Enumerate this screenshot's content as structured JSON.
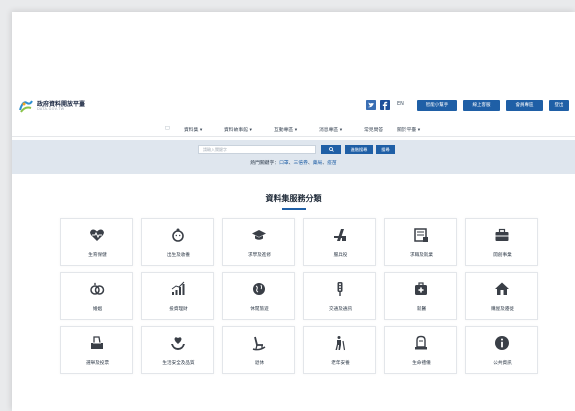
{
  "header": {
    "site_title": "政府資料開放平臺",
    "site_subtitle": "DATA.GOV.TW",
    "social_icons": [
      "twitter-icon",
      "facebook-icon"
    ],
    "language": "EN",
    "buttons": [
      "智能小幫手",
      "線上客服",
      "會員專區",
      "登出"
    ]
  },
  "nav": {
    "items": [
      "□",
      "資料集 ▾",
      "資料故事館 ▾",
      "互動專區 ▾",
      "消息專區 ▾",
      "常見問答",
      "關於平臺 ▾"
    ]
  },
  "search": {
    "placeholder": "請輸入關鍵字",
    "search_icon": "search-icon",
    "advanced_label": "進階搜尋",
    "extra_label": "搜尋",
    "hot_prefix": "熱門關鍵字：",
    "hot_keywords": [
      "口罩",
      "三倍券",
      "藥局",
      "疫苗"
    ],
    "hot_separator": "、"
  },
  "section": {
    "title": "資料集服務分類"
  },
  "categories": [
    {
      "label": "生育保健",
      "icon": "heart-monitor-icon"
    },
    {
      "label": "出生及收養",
      "icon": "baby-icon"
    },
    {
      "label": "求學及進修",
      "icon": "graduation-cap-icon"
    },
    {
      "label": "服兵役",
      "icon": "soldier-icon"
    },
    {
      "label": "求職及就業",
      "icon": "job-board-icon"
    },
    {
      "label": "開創事業",
      "icon": "briefcase-icon"
    },
    {
      "label": "婚姻",
      "icon": "rings-icon"
    },
    {
      "label": "投資理財",
      "icon": "growth-chart-icon"
    },
    {
      "label": "休閒旅遊",
      "icon": "globe-travel-icon"
    },
    {
      "label": "交通及通訊",
      "icon": "traffic-light-icon"
    },
    {
      "label": "就醫",
      "icon": "medical-kit-icon"
    },
    {
      "label": "購屋及遷徙",
      "icon": "house-icon"
    },
    {
      "label": "選舉及投票",
      "icon": "ballot-box-icon"
    },
    {
      "label": "生活安全及品質",
      "icon": "safety-hands-icon"
    },
    {
      "label": "退休",
      "icon": "rocking-chair-icon"
    },
    {
      "label": "老年安養",
      "icon": "elderly-icon"
    },
    {
      "label": "生命禮儀",
      "icon": "memorial-icon"
    },
    {
      "label": "公共資訊",
      "icon": "info-icon"
    }
  ],
  "colors": {
    "primary": "#1f5fa6",
    "search_band": "#dfe6ee",
    "text_dark": "#1f2a38"
  }
}
